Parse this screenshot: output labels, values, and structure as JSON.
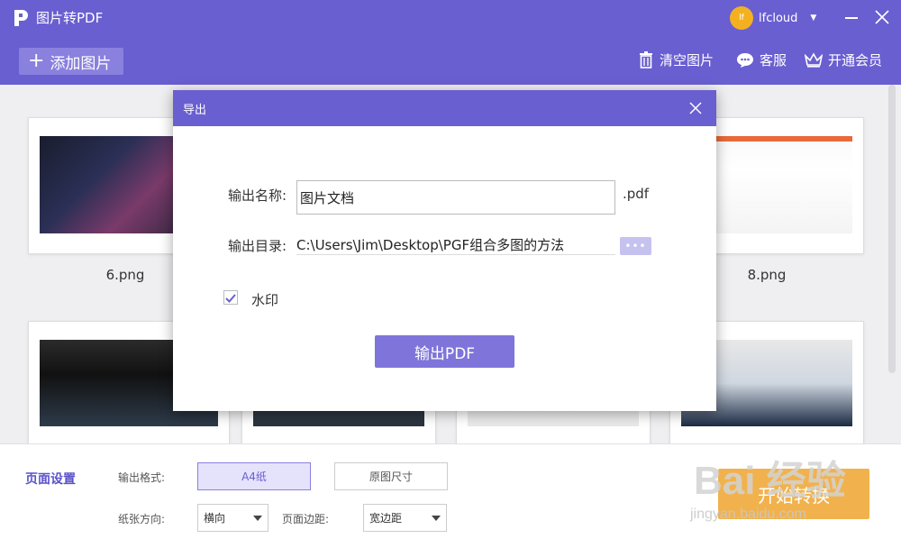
{
  "app": {
    "title": "图片转PDF"
  },
  "user": {
    "avatar_text": "lf",
    "name": "lfcloud"
  },
  "toolbar": {
    "add_label": "添加图片",
    "clear_label": "清空图片",
    "service_label": "客服",
    "vip_label": "开通会员"
  },
  "thumbnails": [
    {
      "label": "6.png"
    },
    {
      "label": "8.png"
    }
  ],
  "dialog": {
    "title": "导出",
    "name_label": "输出名称:",
    "name_value": "图片文档",
    "extension": ".pdf",
    "dir_label": "输出目录:",
    "dir_value": "C:\\Users\\Jim\\Desktop\\PGF组合多图的方法",
    "browse_label": "•••",
    "watermark_label": "水印",
    "watermark_checked": true,
    "export_label": "输出PDF"
  },
  "settings": {
    "section_label": "页面设置",
    "format_label": "输出格式:",
    "format_a4": "A4纸",
    "format_original": "原图尺寸",
    "orientation_label": "纸张方向:",
    "orientation_value": "横向",
    "margin_label": "页面边距:",
    "margin_value": "宽边距",
    "convert_label": "开始转换"
  },
  "watermark": {
    "brand": "Bai 经验",
    "url": "jingyan.baidu.com"
  },
  "colors": {
    "primary": "#6a5fd0",
    "accent": "#f1b24d",
    "button": "#7f74da"
  }
}
